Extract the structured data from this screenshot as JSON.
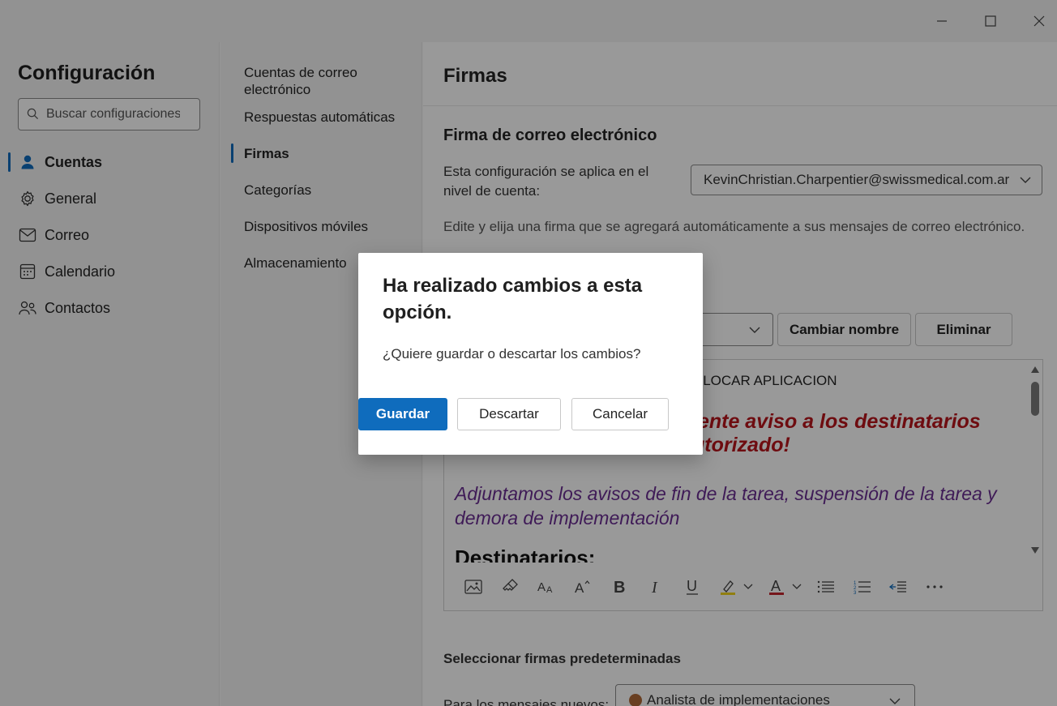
{
  "window": {
    "minimize_icon": "minimize-icon",
    "maximize_icon": "maximize-icon",
    "close_icon": "close-icon"
  },
  "sidebar": {
    "title": "Configuración",
    "search_placeholder": "Buscar configuraciones",
    "items": [
      {
        "label": "Cuentas",
        "icon": "person-icon",
        "active": true
      },
      {
        "label": "General",
        "icon": "gear-icon",
        "active": false
      },
      {
        "label": "Correo",
        "icon": "mail-icon",
        "active": false
      },
      {
        "label": "Calendario",
        "icon": "calendar-icon",
        "active": false
      },
      {
        "label": "Contactos",
        "icon": "people-icon",
        "active": false
      }
    ]
  },
  "subnav": {
    "items": [
      {
        "label": "Cuentas de correo electrónico",
        "active": false
      },
      {
        "label": "Respuestas automáticas",
        "active": false
      },
      {
        "label": "Firmas",
        "active": true
      },
      {
        "label": "Categorías",
        "active": false
      },
      {
        "label": "Dispositivos móviles",
        "active": false
      },
      {
        "label": "Almacenamiento",
        "active": false
      }
    ]
  },
  "main": {
    "title": "Firmas",
    "section_title": "Firma de correo electrónico",
    "apply_label": "Esta configuración se aplica en el nivel de cuenta:",
    "account": "KevinChristian.Charpentier@swissmedical.com.ar",
    "description": "Edite y elija una firma que se agregará automáticamente a sus mensajes de correo electrónico.",
    "rename_button": "Cambiar nombre",
    "delete_button": "Eliminar",
    "editor": {
      "line1": "OLOCAR APLICACION",
      "red_line1": "iente aviso a los destinatarios",
      "red_line2": "utorizado!",
      "purple_text": "Adjuntamos los avisos de fin de la tarea, suspensión de la tarea y demora de implementación",
      "heading": "Destinatarios:"
    },
    "defaults_title": "Seleccionar firmas predeterminadas",
    "new_messages_label": "Para los mensajes nuevos:",
    "new_messages_value": "Analista de implementaciones"
  },
  "dialog": {
    "title": "Ha realizado cambios a esta opción.",
    "body": "¿Quiere guardar o descartar los cambios?",
    "save": "Guardar",
    "discard": "Descartar",
    "cancel": "Cancelar"
  },
  "colors": {
    "accent": "#0f6cbd",
    "signature_red": "#b8141c",
    "signature_purple": "#6a2d91",
    "overlay": "rgba(0,0,0,0.4)"
  }
}
